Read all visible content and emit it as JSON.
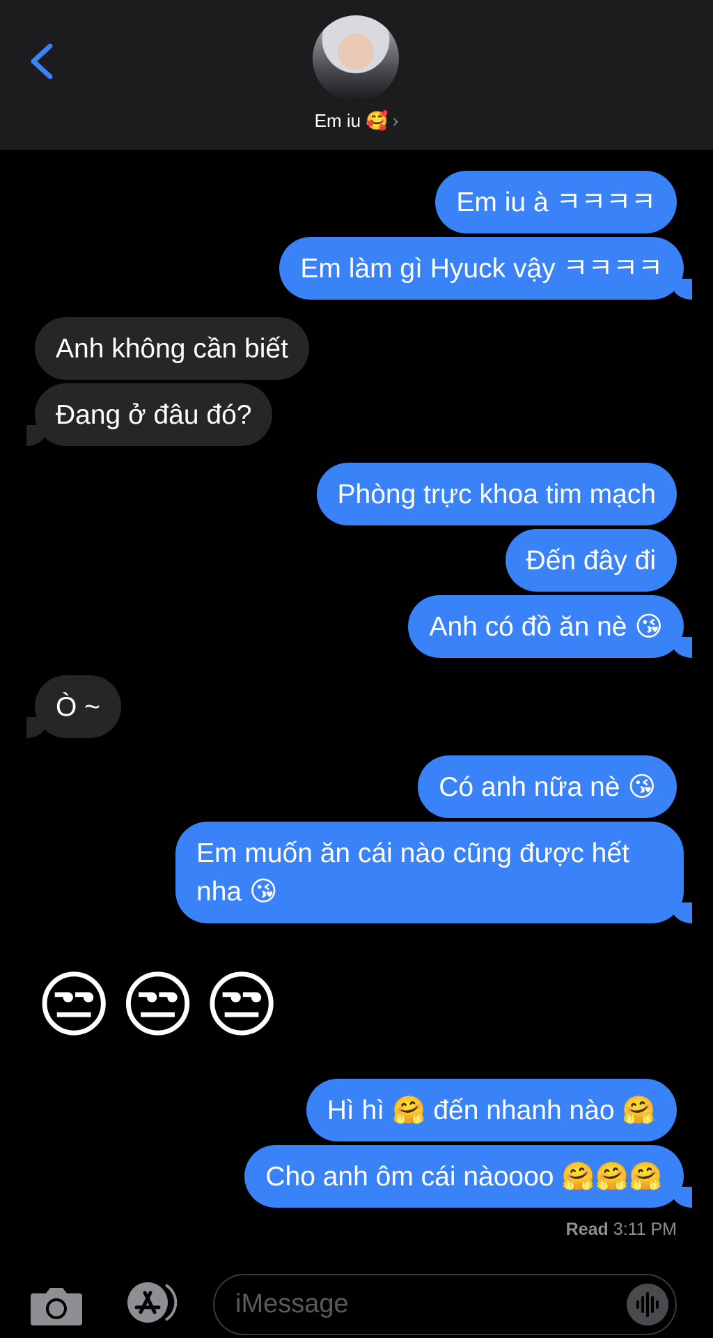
{
  "header": {
    "contact_name": "Em iu 🥰",
    "chevron": "›",
    "back_icon": "chevron-left-icon"
  },
  "messages": [
    {
      "text": "Em iu à ㅋㅋㅋㅋ",
      "dir": "out"
    },
    {
      "text": "Em làm gì Hyuck vậy ㅋㅋㅋㅋ",
      "dir": "out"
    },
    {
      "text": "Anh không cần biết",
      "dir": "in"
    },
    {
      "text": "Đang ở đâu đó?",
      "dir": "in"
    },
    {
      "text": "Phòng trực khoa tim mạch",
      "dir": "out"
    },
    {
      "text": "Đến đây đi",
      "dir": "out"
    },
    {
      "text": "Anh có đồ ăn nè 😘",
      "dir": "out"
    },
    {
      "text": "Ò ~",
      "dir": "in"
    },
    {
      "text": "Có anh nữa nè 😘",
      "dir": "out"
    },
    {
      "text": "Em muốn ăn cái nào cũng được hết",
      "dir": "out"
    },
    {
      "text": "nha 😘",
      "dir": "out"
    },
    {
      "text": "😒😒😒",
      "dir": "in"
    },
    {
      "text": "Hì hì 🤗 đến nhanh nào 🤗",
      "dir": "out"
    },
    {
      "text": "Cho anh ôm cái nàoooo 🤗🤗🤗",
      "dir": "out"
    }
  ],
  "read_receipt": {
    "label": "Read",
    "time": "3:11 PM"
  },
  "input": {
    "placeholder": "iMessage"
  },
  "colors": {
    "outgoing": "#3a82f7",
    "incoming": "#262628",
    "accent": "#3a82f7"
  }
}
